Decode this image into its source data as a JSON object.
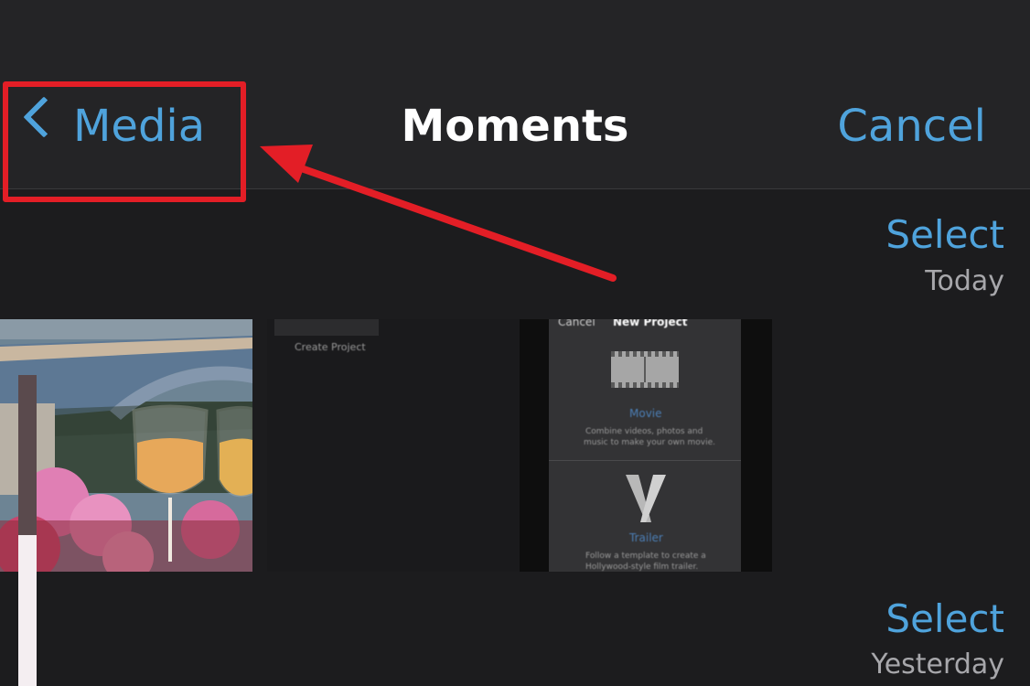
{
  "navbar": {
    "back_label": "Media",
    "title": "Moments",
    "cancel_label": "Cancel"
  },
  "sections": [
    {
      "select_label": "Select",
      "date": "Today"
    },
    {
      "select_label": "Select",
      "date": "Yesterday"
    }
  ],
  "thumbnails": {
    "dark": {
      "label": "Create Project"
    },
    "screen": {
      "cancel": "Cancel",
      "title": "New Project",
      "movie_label": "Movie",
      "movie_desc_1": "Combine videos, photos and",
      "movie_desc_2": "music to make your own movie.",
      "trailer_label": "Trailer",
      "trailer_desc_1": "Follow a template to create a",
      "trailer_desc_2": "Hollywood-style film trailer."
    }
  },
  "colors": {
    "accent": "#4fa3dc",
    "annotation": "#e31e26",
    "background": "#1c1c1e"
  }
}
